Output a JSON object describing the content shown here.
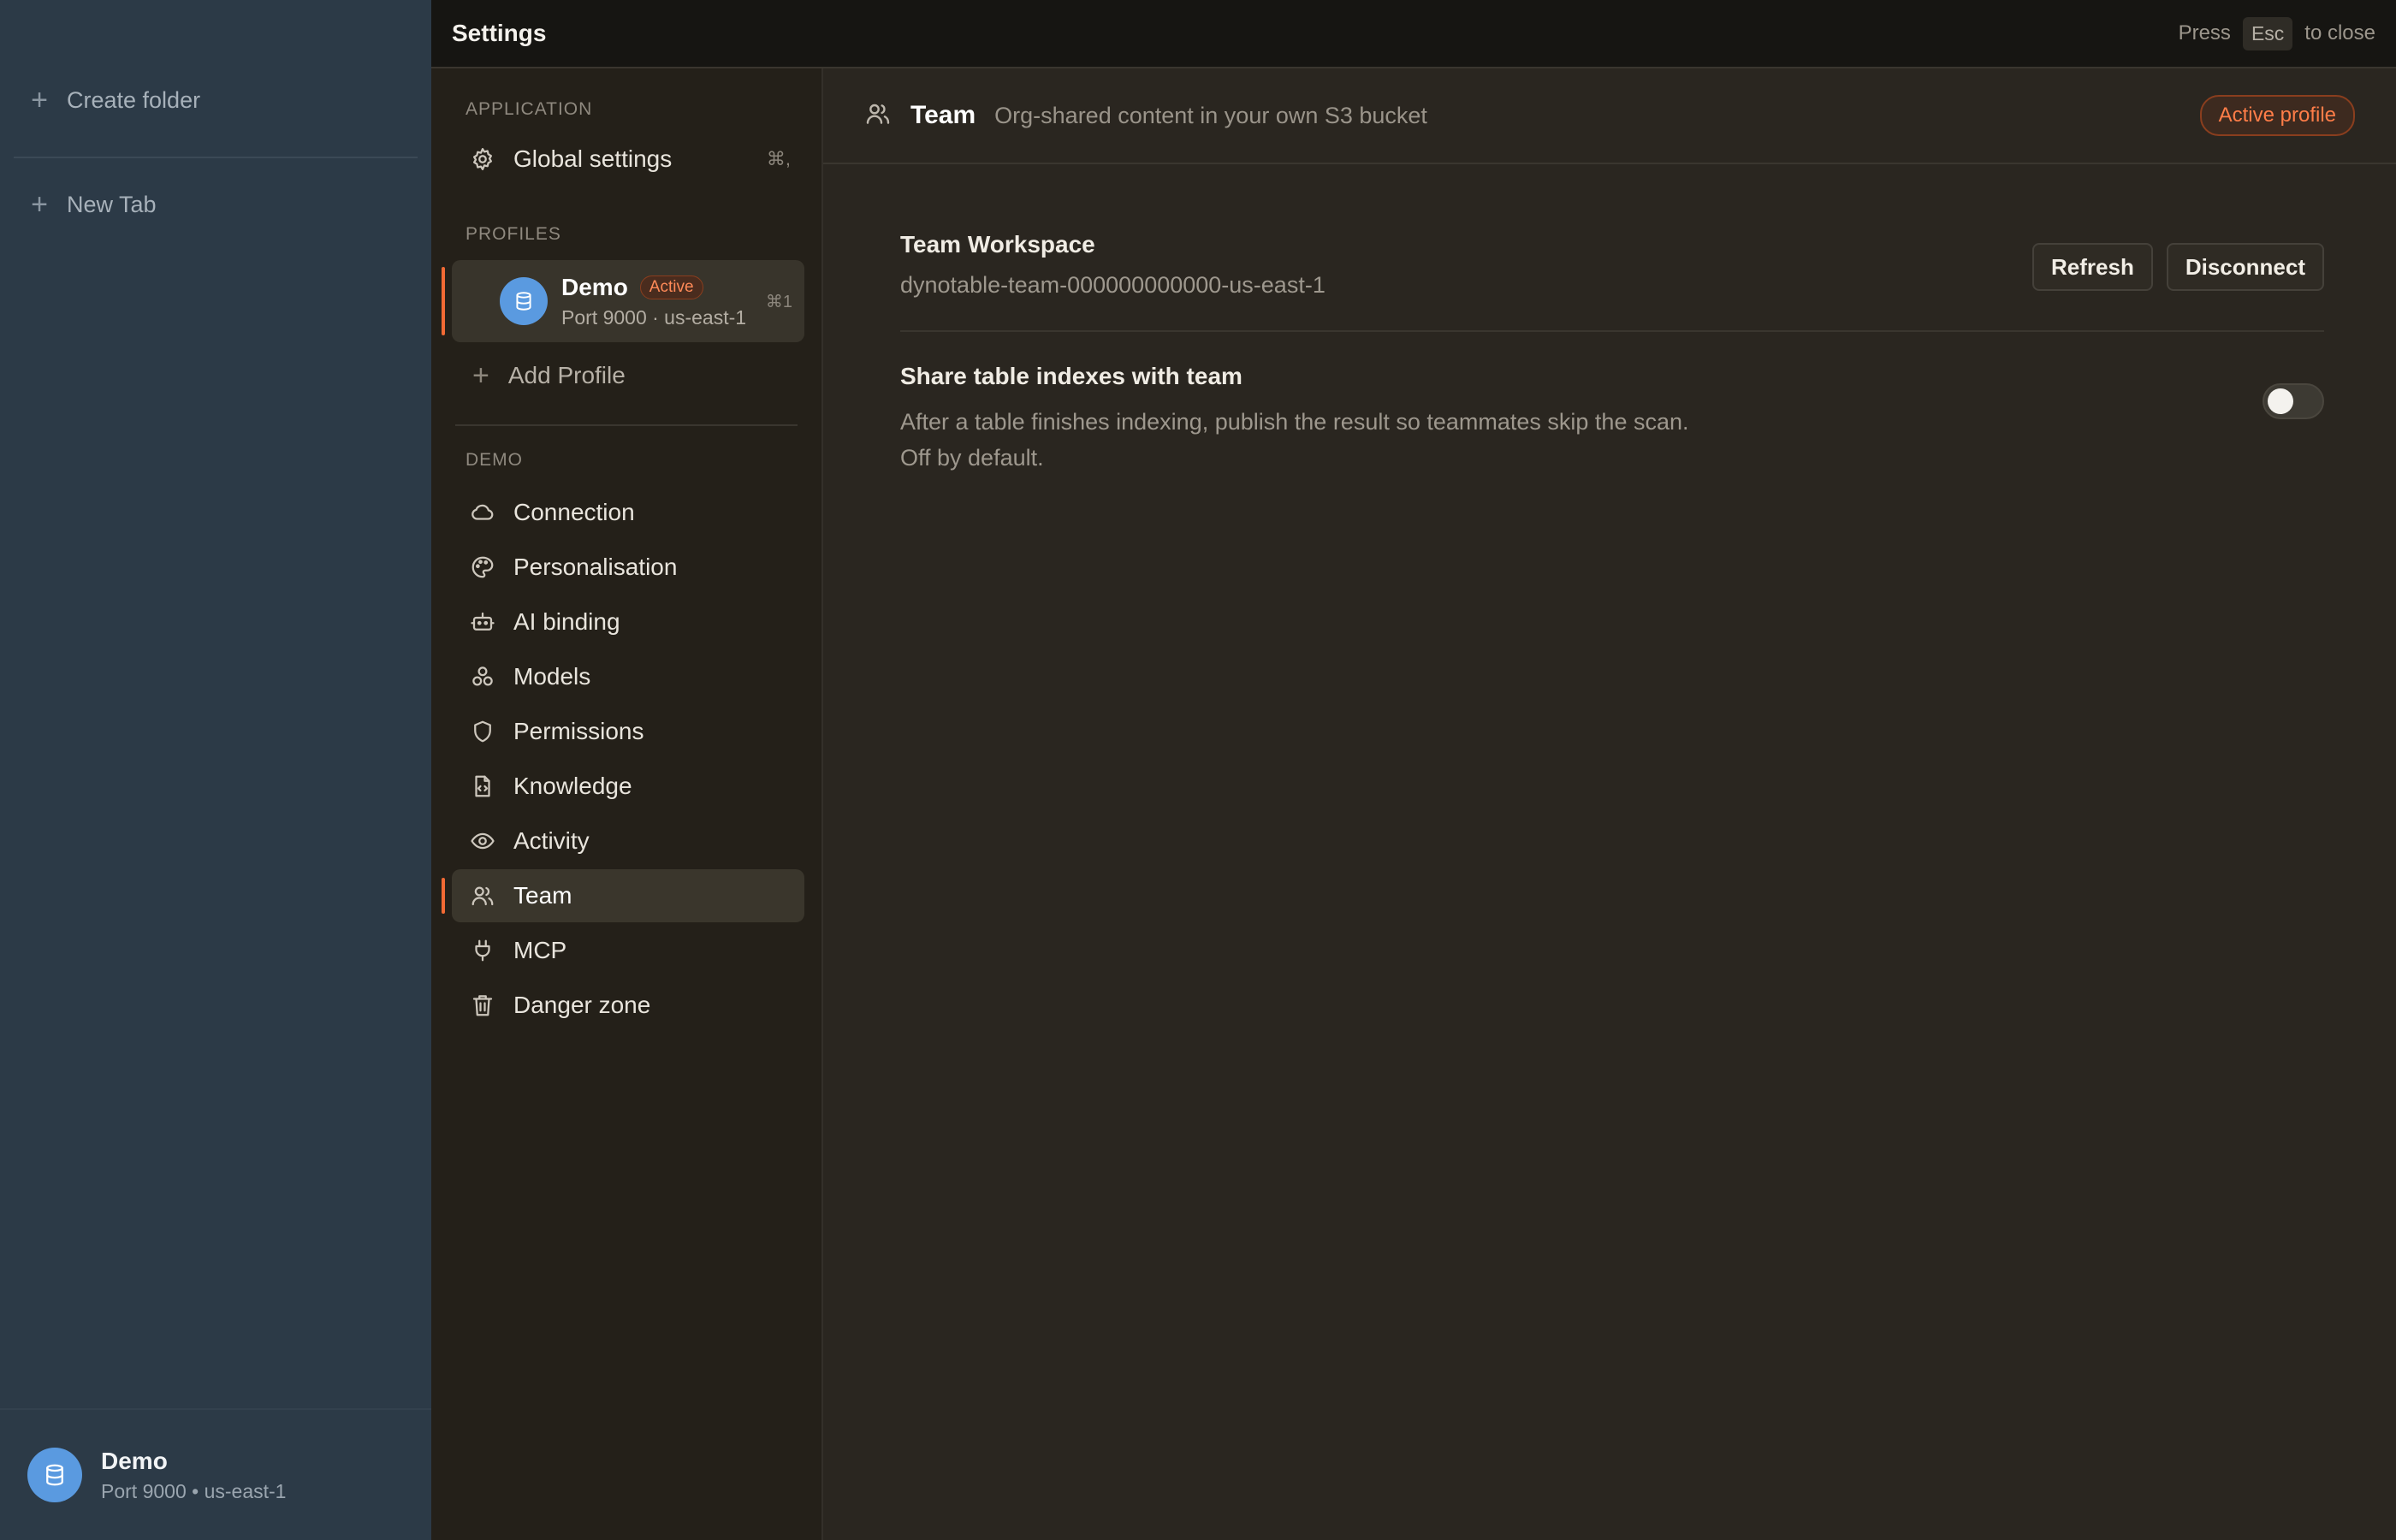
{
  "sidebar": {
    "create_folder": "Create folder",
    "new_tab": "New Tab",
    "footer": {
      "name": "Demo",
      "sub": "Port 9000 • us-east-1"
    }
  },
  "topbar": {
    "title": "Settings",
    "hint_prefix": "Press",
    "hint_key": "Esc",
    "hint_suffix": "to close"
  },
  "nav": {
    "application_heading": "APPLICATION",
    "global_settings": {
      "label": "Global settings",
      "shortcut": "⌘,"
    },
    "profiles_heading": "PROFILES",
    "profile": {
      "name": "Demo",
      "badge": "Active",
      "sub": "Port 9000 · us-east-1",
      "shortcut": "⌘1"
    },
    "add_profile": "Add Profile",
    "demo_heading": "DEMO",
    "items": [
      {
        "label": "Connection",
        "icon": "cloud-icon"
      },
      {
        "label": "Personalisation",
        "icon": "palette-icon"
      },
      {
        "label": "AI binding",
        "icon": "robot-icon"
      },
      {
        "label": "Models",
        "icon": "models-icon"
      },
      {
        "label": "Permissions",
        "icon": "shield-icon"
      },
      {
        "label": "Knowledge",
        "icon": "file-code-icon"
      },
      {
        "label": "Activity",
        "icon": "eye-icon"
      },
      {
        "label": "Team",
        "icon": "users-icon"
      },
      {
        "label": "MCP",
        "icon": "plug-icon"
      },
      {
        "label": "Danger zone",
        "icon": "trash-icon"
      }
    ],
    "selected": "Team"
  },
  "content": {
    "title": "Team",
    "subtitle": "Org-shared content in your own S3 bucket",
    "badge": "Active profile",
    "workspace": {
      "title": "Team Workspace",
      "value": "dynotable-team-000000000000-us-east-1",
      "refresh": "Refresh",
      "disconnect": "Disconnect"
    },
    "share": {
      "title": "Share table indexes with team",
      "line1": "After a table finishes indexing, publish the result so teammates skip the scan.",
      "line2": "Off by default.",
      "enabled": false
    }
  },
  "colors": {
    "accent": "#f26a34",
    "sidebar_bg": "#2c3a47",
    "panel_bg": "#2a2620",
    "avatar": "#5a9ae0"
  }
}
